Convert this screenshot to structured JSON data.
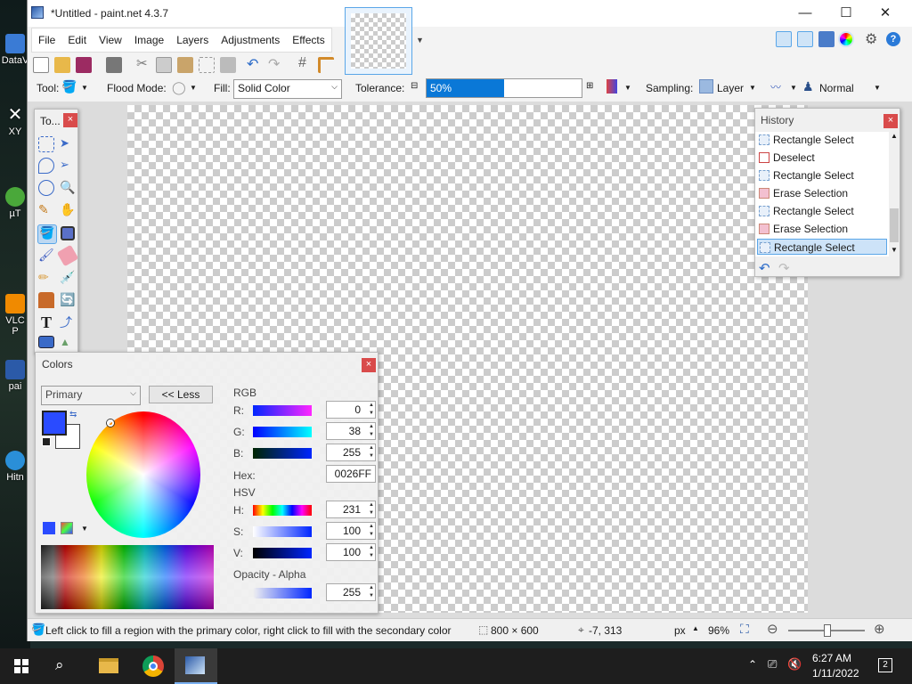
{
  "desktop": {
    "items": [
      {
        "label": "DataV"
      },
      {
        "label": "XY"
      },
      {
        "label": "µT"
      },
      {
        "label": "VLC"
      },
      {
        "label": "P"
      },
      {
        "label": "pai"
      },
      {
        "label": "Hitn"
      }
    ]
  },
  "window": {
    "title": "*Untitled - paint.net 4.3.7"
  },
  "menu": {
    "items": [
      "File",
      "Edit",
      "View",
      "Image",
      "Layers",
      "Adjustments",
      "Effects"
    ]
  },
  "toolbar": {
    "tool_label": "Tool:",
    "flood_mode_label": "Flood Mode:",
    "fill_label": "Fill:",
    "fill_value": "Solid Color",
    "tolerance_label": "Tolerance:",
    "tolerance_value": "50%",
    "tolerance_fraction": 0.5,
    "sampling_label": "Sampling:",
    "sampling_value": "Layer",
    "blend_value": "Normal"
  },
  "tools_panel": {
    "title": "To..."
  },
  "history": {
    "title": "History",
    "items": [
      "Rectangle Select",
      "Deselect",
      "Rectangle Select",
      "Erase Selection",
      "Rectangle Select",
      "Erase Selection",
      "Rectangle Select"
    ]
  },
  "colors": {
    "title": "Colors",
    "mode": "Primary",
    "less_button": "<< Less",
    "rgb_label": "RGB",
    "r_label": "R:",
    "r": "0",
    "g_label": "G:",
    "g": "38",
    "b_label": "B:",
    "b": "255",
    "hex_label": "Hex:",
    "hex": "0026FF",
    "hsv_label": "HSV",
    "h_label": "H:",
    "h": "231",
    "s_label": "S:",
    "s": "100",
    "v_label": "V:",
    "v": "100",
    "opacity_label": "Opacity - Alpha",
    "alpha": "255",
    "primary_color": "#2a4bff",
    "secondary_color": "#ffffff"
  },
  "status": {
    "hint": "Left click to fill a region with the primary color, right click to fill with the secondary color",
    "image_size": "800 × 600",
    "cursor_pos": "-7, 313",
    "unit": "px",
    "zoom": "96%"
  },
  "taskbar": {
    "time": "6:27 AM",
    "date": "1/11/2022",
    "notif_count": "2"
  }
}
